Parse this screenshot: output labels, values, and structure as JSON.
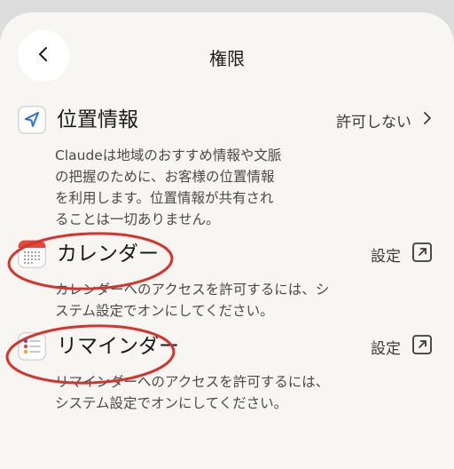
{
  "header": {
    "title": "権限"
  },
  "permissions": {
    "location": {
      "title": "位置情報",
      "action": "許可しない",
      "desc": [
        "Claudeは地域のおすすめ情報や文脈",
        "の把握のために、お客様の位置情報",
        "を利用します。位置情報が共有され",
        "ることは一切ありません。"
      ]
    },
    "calendar": {
      "title": "カレンダー",
      "action": "設定",
      "desc": [
        "カレンダーへのアクセスを許可するには、シ",
        "ステム設定でオンにしてください。"
      ]
    },
    "reminders": {
      "title": "リマインダー",
      "action": "設定",
      "desc": [
        "リマインダーへのアクセスを許可するには、",
        "システム設定でオンにしてください。"
      ]
    }
  },
  "colors": {
    "background": "#f7f6f2",
    "annotation": "#d9322a",
    "accent": "#2d6fd6"
  },
  "icons": {
    "back": "chevron-left-icon",
    "location": "location-arrow-icon",
    "calendar": "calendar-icon",
    "reminders": "reminders-list-icon",
    "external": "external-link-icon",
    "chevron": "chevron-right-icon"
  }
}
